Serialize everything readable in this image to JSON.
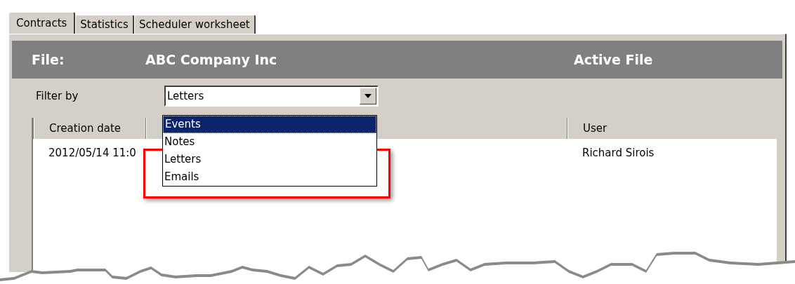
{
  "tabs": [
    {
      "label": "Contracts",
      "selected": true
    },
    {
      "label": "Statistics",
      "selected": false
    },
    {
      "label": "Scheduler worksheet",
      "selected": false
    }
  ],
  "file_bar": {
    "label": "File:",
    "name": "ABC Company Inc",
    "status": "Active File"
  },
  "filter": {
    "label": "Filter by",
    "value": "Letters",
    "expanded": true,
    "options": [
      {
        "label": "Events",
        "highlighted": true
      },
      {
        "label": "Notes",
        "highlighted": false
      },
      {
        "label": "Letters",
        "highlighted": false
      },
      {
        "label": "Emails",
        "highlighted": false
      }
    ]
  },
  "table": {
    "columns": [
      "Creation date",
      "",
      "User"
    ],
    "rows": [
      [
        "2012/05/14 11:0",
        "",
        "Richard Sirois"
      ]
    ]
  }
}
